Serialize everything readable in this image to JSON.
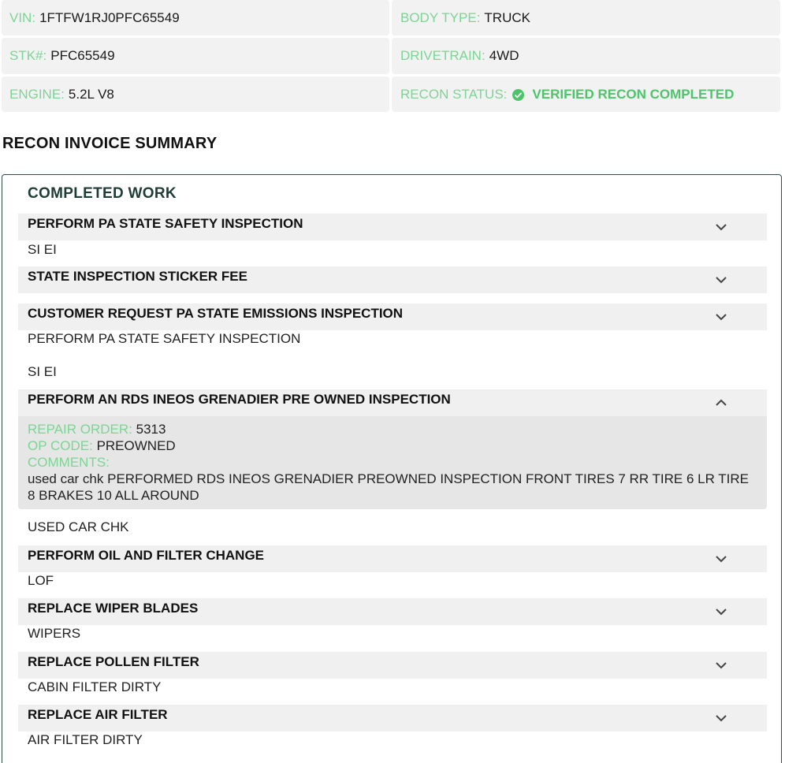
{
  "vehicle": {
    "vin": {
      "label": "VIN:",
      "value": "1FTFW1RJ0PFC65549"
    },
    "body_type": {
      "label": "BODY TYPE:",
      "value": "TRUCK"
    },
    "stk": {
      "label": "STK#:",
      "value": "PFC65549"
    },
    "drivetrain": {
      "label": "DRIVETRAIN:",
      "value": "4WD"
    },
    "engine": {
      "label": "ENGINE:",
      "value": "5.2L V8"
    },
    "recon_status": {
      "label": "RECON STATUS:",
      "value": "VERIFIED RECON COMPLETED",
      "icon": "check-circle-icon"
    }
  },
  "colors": {
    "accent_green": "#7dd494",
    "status_green": "#4cc56a",
    "panel_border": "#2f4f45"
  },
  "summary": {
    "title": "RECON INVOICE SUMMARY",
    "completed_title": "COMPLETED WORK",
    "jobs": [
      {
        "title": "PERFORM PA STATE SAFETY INSPECTION",
        "notes": [
          "SI EI"
        ],
        "expanded": false
      },
      {
        "title": "STATE INSPECTION STICKER FEE",
        "notes": [],
        "expanded": false
      },
      {
        "title": "CUSTOMER REQUEST PA STATE EMISSIONS INSPECTION",
        "notes": [
          "PERFORM PA STATE SAFETY INSPECTION",
          "SI EI"
        ],
        "expanded": false
      },
      {
        "title": "PERFORM AN RDS INEOS GRENADIER PRE OWNED INSPECTION",
        "expanded": true,
        "details": {
          "repair_order_label": "REPAIR ORDER:",
          "repair_order": "5313",
          "op_code_label": "OP CODE:",
          "op_code": "PREOWNED",
          "comments_label": "COMMENTS:",
          "comments": "used car chk PERFORMED RDS INEOS GRENADIER PREOWNED INSPECTION FRONT TIRES 7 RR TIRE 6 LR TIRE 8 BRAKES 10 ALL AROUND"
        },
        "notes": [
          "USED CAR CHK"
        ]
      },
      {
        "title": "PERFORM OIL AND FILTER CHANGE",
        "notes": [
          "LOF"
        ],
        "expanded": false
      },
      {
        "title": "REPLACE WIPER BLADES",
        "notes": [
          "WIPERS"
        ],
        "expanded": false
      },
      {
        "title": "REPLACE POLLEN FILTER",
        "notes": [
          "CABIN FILTER DIRTY"
        ],
        "expanded": false
      },
      {
        "title": "REPLACE AIR FILTER",
        "notes": [
          "AIR FILTER DIRTY"
        ],
        "expanded": false
      }
    ]
  }
}
